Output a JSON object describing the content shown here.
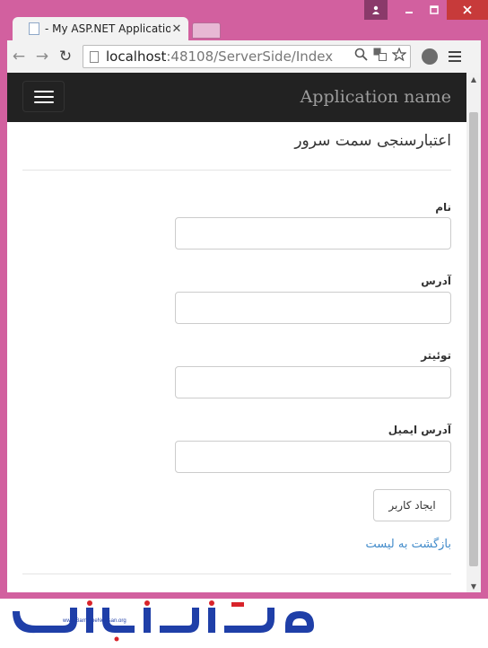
{
  "browser": {
    "tab_title": "- My ASP.NET Application",
    "url_host": "localhost",
    "url_path": ":48108/ServerSide/Index"
  },
  "navbar": {
    "brand": "Application name"
  },
  "page": {
    "heading": "اعتبارسنجی سمت سرور",
    "fields": [
      {
        "label": "نام",
        "value": ""
      },
      {
        "label": "آدرس",
        "value": ""
      },
      {
        "label": "توئیتر",
        "value": ""
      },
      {
        "label": "آدرس ایمیل",
        "value": ""
      }
    ],
    "submit_label": "ایجاد کاربر",
    "back_link": "بازگشت به لیست"
  },
  "watermark": {
    "logo_text": "برنامه نویسان",
    "site": "www.BarnameNevisan.org"
  },
  "colors": {
    "frame": "#d2609f",
    "navbar": "#222222",
    "link": "#428bca",
    "logo_blue": "#1f3fa8",
    "logo_red": "#d8232a"
  }
}
